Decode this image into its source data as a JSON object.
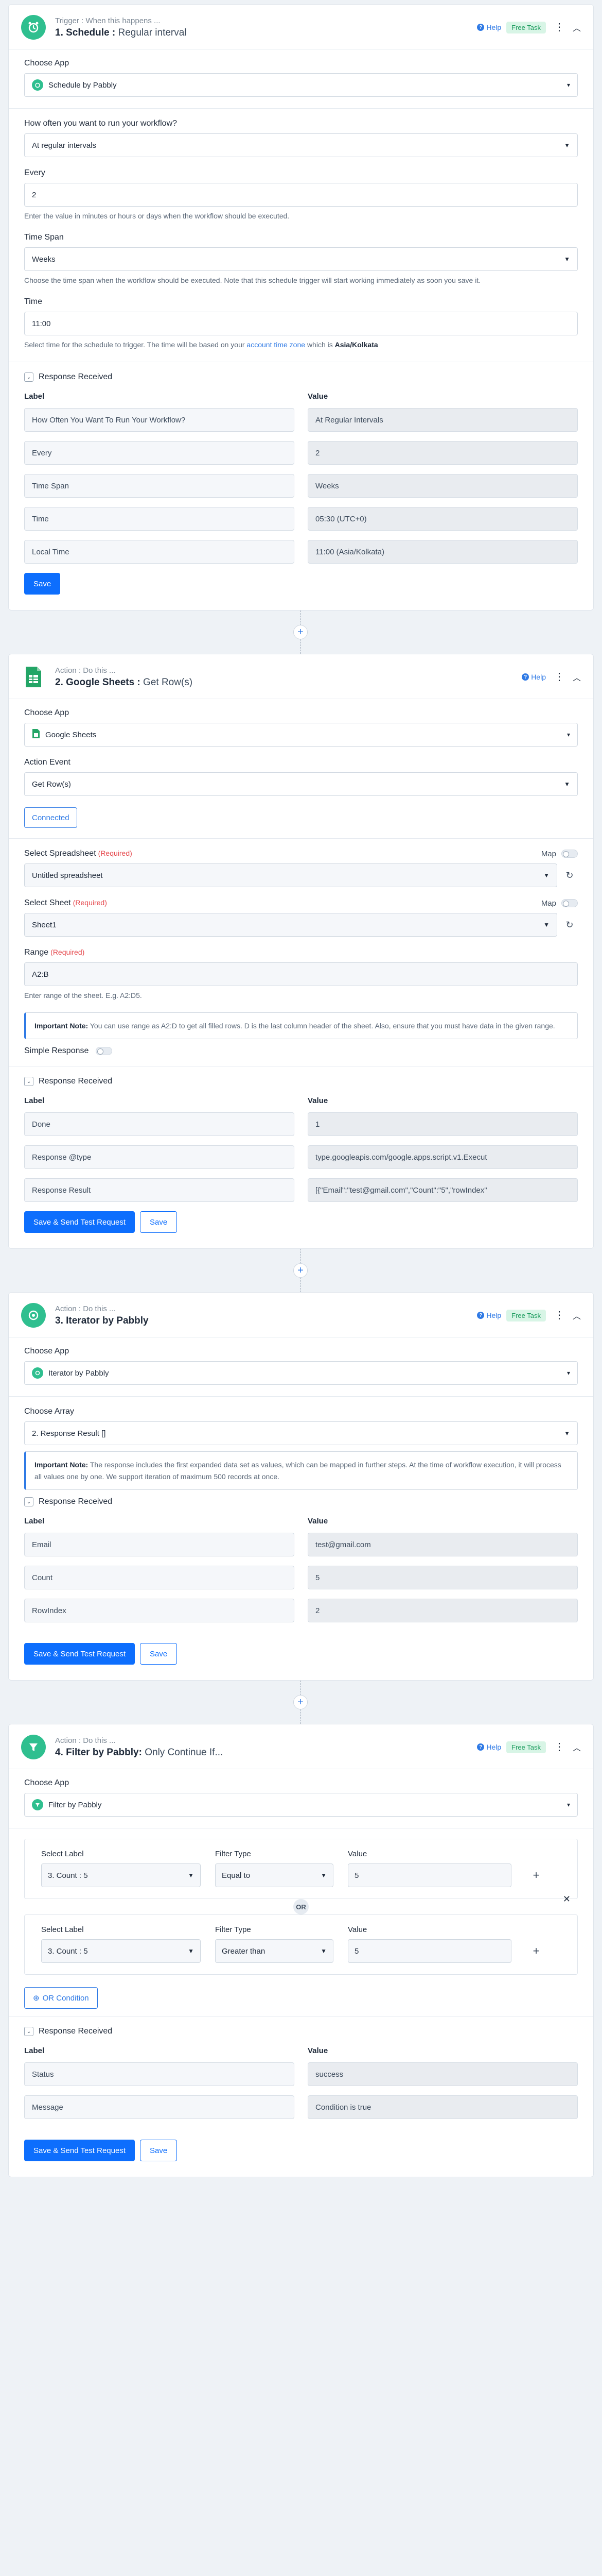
{
  "common": {
    "help": "Help",
    "free_task": "Free Task",
    "choose_app": "Choose App",
    "response_received": "Response Received",
    "col_label": "Label",
    "col_value": "Value",
    "save": "Save",
    "save_test": "Save & Send Test Request"
  },
  "step1": {
    "kicker": "Trigger : When this happens ...",
    "title_num": "1. Schedule :",
    "title_sub": "Regular interval",
    "app": "Schedule by Pabbly",
    "q_how": "How often you want to run your workflow?",
    "how_value": "At regular intervals",
    "every_label": "Every",
    "every_value": "2",
    "every_help": "Enter the value in minutes or hours or days when the workflow should be executed.",
    "span_label": "Time Span",
    "span_value": "Weeks",
    "span_help": "Choose the time span when the workflow should be executed. Note that this schedule trigger will start working immediately as soon you save it.",
    "time_label": "Time",
    "time_value": "11:00",
    "time_help_pre": "Select time for the schedule to trigger. The time will be based on your",
    "time_help_link": "account time zone",
    "time_help_mid": "which is",
    "time_help_tz": "Asia/Kolkata",
    "response": [
      {
        "k": "How Often You Want To Run Your Workflow?",
        "v": "At Regular Intervals"
      },
      {
        "k": "Every",
        "v": "2"
      },
      {
        "k": "Time Span",
        "v": "Weeks"
      },
      {
        "k": "Time",
        "v": "05:30 (UTC+0)"
      },
      {
        "k": "Local Time",
        "v": "11:00 (Asia/Kolkata)"
      }
    ]
  },
  "step2": {
    "kicker": "Action : Do this ...",
    "title_num": "2. Google Sheets :",
    "title_sub": "Get Row(s)",
    "app": "Google Sheets",
    "event_label": "Action Event",
    "event_value": "Get Row(s)",
    "connected": "Connected",
    "spreadsheet_label": "Select Spreadsheet",
    "required": "(Required)",
    "map": "Map",
    "spreadsheet_value": "Untitled spreadsheet",
    "sheet_label": "Select Sheet",
    "sheet_value": "Sheet1",
    "range_label": "Range",
    "range_value": "A2:B",
    "range_help": "Enter range of the sheet. E.g. A2:D5.",
    "note_title": "Important Note:",
    "note_body": "You can use range as A2:D to get all filled rows. D is the last column header of the sheet. Also, ensure that you must have data in the given range.",
    "simple_response": "Simple Response",
    "response": [
      {
        "k": "Done",
        "v": "1"
      },
      {
        "k": "Response @type",
        "v": "type.googleapis.com/google.apps.script.v1.Execut"
      },
      {
        "k": "Response Result",
        "v": "[{\"Email\":\"test@gmail.com\",\"Count\":\"5\",\"rowIndex\""
      }
    ]
  },
  "step3": {
    "kicker": "Action : Do this ...",
    "title_num": "3. Iterator by Pabbly",
    "app": "Iterator by Pabbly",
    "array_label": "Choose Array",
    "array_value": "2. Response Result []",
    "note_title": "Important Note:",
    "note_body": "The response includes the first expanded data set as values, which can be mapped in further steps. At the time of workflow execution, it will process all values one by one. We support iteration of maximum 500 records at once.",
    "response": [
      {
        "k": "Email",
        "v": "test@gmail.com"
      },
      {
        "k": "Count",
        "v": "5"
      },
      {
        "k": "RowIndex",
        "v": "2"
      }
    ]
  },
  "step4": {
    "kicker": "Action : Do this ...",
    "title_num": "4. Filter by Pabbly:",
    "title_sub": "Only Continue If...",
    "app": "Filter by Pabbly",
    "select_label": "Select Label",
    "filter_type": "Filter Type",
    "value_label": "Value",
    "or": "OR",
    "cond1": {
      "label": "3. Count : 5",
      "type": "Equal to",
      "value": "5"
    },
    "cond2": {
      "label": "3. Count : 5",
      "type": "Greater than",
      "value": "5"
    },
    "or_condition": "OR Condition",
    "response": [
      {
        "k": "Status",
        "v": "success"
      },
      {
        "k": "Message",
        "v": "Condition is true"
      }
    ]
  },
  "colors": {
    "primary": "#0d6efd",
    "accent_green": "#2fbf8f",
    "sheets_green": "#23a566",
    "link_blue": "#2f7ae5"
  }
}
